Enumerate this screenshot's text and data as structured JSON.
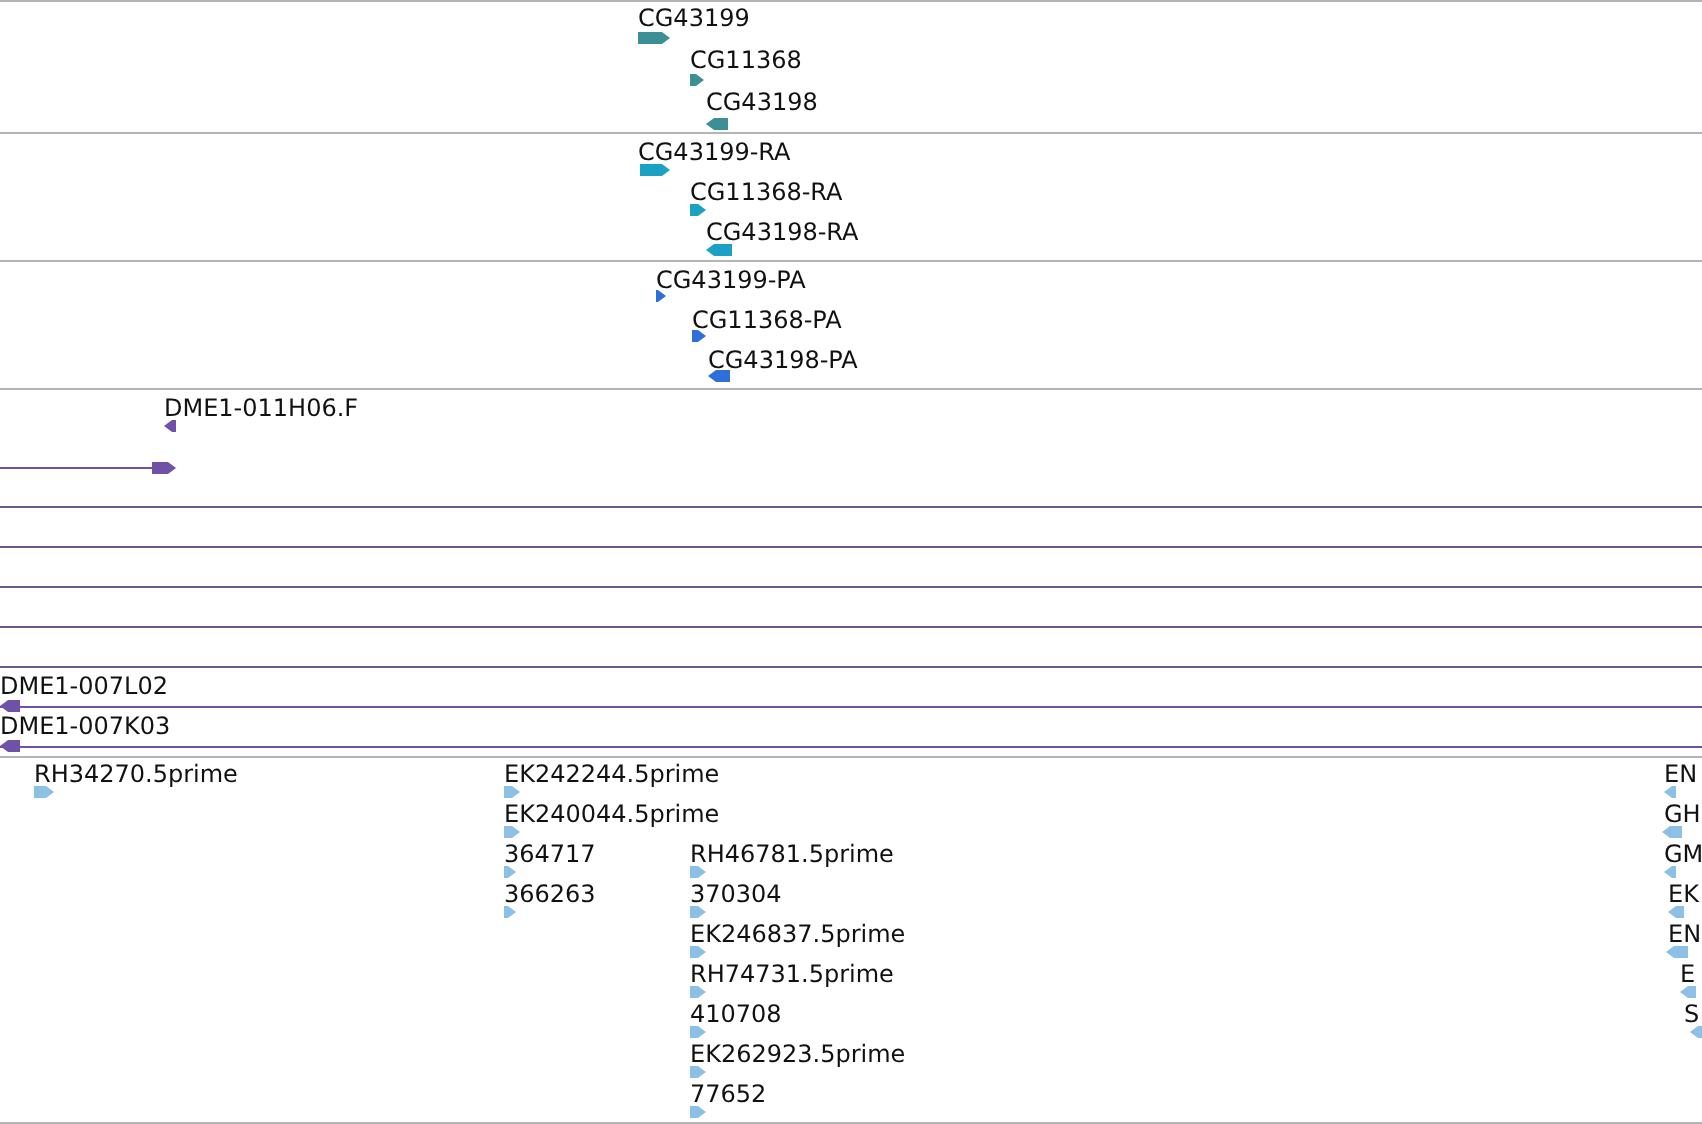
{
  "tracks": [
    {
      "kind": "gene",
      "features": [
        {
          "label": "CG43199",
          "reverse": false
        },
        {
          "label": "CG11368",
          "reverse": false
        },
        {
          "label": "CG43198",
          "reverse": true
        }
      ]
    },
    {
      "kind": "transcript",
      "features": [
        {
          "label": "CG43199-RA",
          "reverse": false
        },
        {
          "label": "CG11368-RA",
          "reverse": false
        },
        {
          "label": "CG43198-RA",
          "reverse": true
        }
      ]
    },
    {
      "kind": "protein",
      "features": [
        {
          "label": "CG43199-PA",
          "reverse": false
        },
        {
          "label": "CG11368-PA",
          "reverse": false
        },
        {
          "label": "CG43198-PA",
          "reverse": true
        }
      ]
    },
    {
      "kind": "clone",
      "features": [
        {
          "label": "DME1-011H06.F",
          "reverse": true,
          "kind": "tick"
        },
        {
          "label": "DME1-007L02",
          "reverse": true,
          "kind": "span"
        },
        {
          "label": "DME1-007K03",
          "reverse": true,
          "kind": "span"
        }
      ]
    },
    {
      "kind": "est",
      "features": [
        {
          "label": "RH34270.5prime",
          "reverse": false
        },
        {
          "label": "EK242244.5prime",
          "reverse": false
        },
        {
          "label": "EK240044.5prime",
          "reverse": false
        },
        {
          "label": "364717",
          "reverse": false
        },
        {
          "label": "366263",
          "reverse": false
        },
        {
          "label": "RH46781.5prime",
          "reverse": false
        },
        {
          "label": "370304",
          "reverse": false
        },
        {
          "label": "EK246837.5prime",
          "reverse": false
        },
        {
          "label": "RH74731.5prime",
          "reverse": false
        },
        {
          "label": "410708",
          "reverse": false
        },
        {
          "label": "EK262923.5prime",
          "reverse": false
        },
        {
          "label": "77652",
          "reverse": false
        },
        {
          "label": "EN",
          "reverse": true
        },
        {
          "label": "GH",
          "reverse": true
        },
        {
          "label": "GM",
          "reverse": true
        },
        {
          "label": "EK",
          "reverse": true
        },
        {
          "label": "EN",
          "reverse": true
        },
        {
          "label": "E",
          "reverse": true
        },
        {
          "label": "S",
          "reverse": true
        }
      ]
    }
  ]
}
